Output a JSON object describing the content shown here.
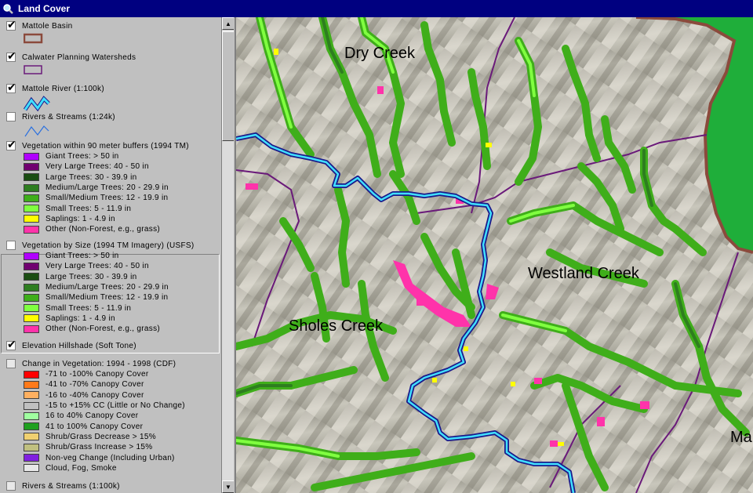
{
  "window": {
    "title": "Land Cover"
  },
  "toc": {
    "layers": [
      {
        "id": "basin",
        "name": "Mattole Basin",
        "checked": true,
        "symbol": "brown-box-icon"
      },
      {
        "id": "calwater",
        "name": "Calwater Planning Watersheds",
        "checked": true,
        "symbol": "purple-box-icon"
      },
      {
        "id": "river",
        "name": "Mattole River (1:100k)",
        "checked": true,
        "symbol": "cyan-line-icon"
      },
      {
        "id": "streams24k",
        "name": "Rivers & Streams (1:24k)",
        "checked": false,
        "symbol": "blue-line-icon"
      },
      {
        "id": "veg90",
        "name": "Vegetation within 90 meter buffers (1994 TM)",
        "checked": true,
        "classes": [
          {
            "label": "Giant Trees: > 50 in",
            "color": "#b000ff"
          },
          {
            "label": "Very Large Trees: 40 - 50 in",
            "color": "#700070"
          },
          {
            "label": "Large Trees: 30 - 39.9 in",
            "color": "#1a4d12"
          },
          {
            "label": "Medium/Large Trees: 20 - 29.9 in",
            "color": "#2e7d20"
          },
          {
            "label": "Small/Medium Trees: 12 - 19.9 in",
            "color": "#3fae1a"
          },
          {
            "label": "Small Trees: 5 - 11.9 in",
            "color": "#80ff40"
          },
          {
            "label": "Saplings: 1 - 4.9 in",
            "color": "#ffff00"
          },
          {
            "label": "Other (Non-Forest, e.g., grass)",
            "color": "#ff33aa"
          }
        ]
      },
      {
        "id": "vegsize",
        "name": "Vegetation by Size (1994 TM Imagery) (USFS)",
        "checked": false,
        "classes": [
          {
            "label": "Giant Trees: > 50 in",
            "color": "#b000ff"
          },
          {
            "label": "Very Large Trees: 40 - 50 in",
            "color": "#700070"
          },
          {
            "label": "Large Trees: 30 - 39.9 in",
            "color": "#1a4d12"
          },
          {
            "label": "Medium/Large Trees: 20 - 29.9 in",
            "color": "#2e7d20"
          },
          {
            "label": "Small/Medium Trees: 12 - 19.9 in",
            "color": "#3fae1a"
          },
          {
            "label": "Small Trees: 5 - 11.9 in",
            "color": "#80ff40"
          },
          {
            "label": "Saplings: 1 - 4.9 in",
            "color": "#ffff00"
          },
          {
            "label": "Other (Non-Forest, e.g., grass)",
            "color": "#ff33aa"
          }
        ]
      },
      {
        "id": "hillshade",
        "name": "Elevation Hillshade (Soft Tone)",
        "checked": true
      },
      {
        "id": "change",
        "name": "Change in Vegetation: 1994 - 1998 (CDF)",
        "checked": false,
        "classes": [
          {
            "label": "-71 to -100% Canopy Cover",
            "color": "#ff0000"
          },
          {
            "label": "-41 to -70% Canopy Cover",
            "color": "#ff7a1a"
          },
          {
            "label": "-16 to -40% Canopy Cover",
            "color": "#ffb060"
          },
          {
            "label": "-15 to +15% CC (Little or No Change)",
            "color": "#c0c0c0"
          },
          {
            "label": "16 to 40% Canopy Cover",
            "color": "#a0ffa0"
          },
          {
            "label": "41 to 100% Canopy Cover",
            "color": "#1fa01f"
          },
          {
            "label": "Shrub/Grass Decrease > 15%",
            "color": "#f0d070"
          },
          {
            "label": "Shrub/Grass Increase > 15%",
            "color": "#c0c080"
          },
          {
            "label": "Non-veg Change (Including Urban)",
            "color": "#8020e0"
          },
          {
            "label": "Cloud, Fog, Smoke",
            "color": "#e8e8e8"
          }
        ]
      },
      {
        "id": "streams100k",
        "name": "Rivers & Streams (1:100k)",
        "checked": false
      }
    ]
  },
  "map": {
    "labels": {
      "dry_creek": "Dry Creek",
      "westland_creek": "Westland Creek",
      "sholes_creek": "Sholes Creek",
      "ma": "Ma"
    },
    "colors": {
      "basin_boundary": "#8b4a3c",
      "watershed_boundary": "#6a1a7a",
      "river_fill": "#40e0ff",
      "river_edge": "#1a1a8a",
      "outside_basin": "#1fae3a",
      "veg_medium": "#3fae1a",
      "veg_small": "#80ff40",
      "veg_other": "#ff33aa"
    }
  },
  "scroll": {
    "up": "▲",
    "down": "▼"
  }
}
